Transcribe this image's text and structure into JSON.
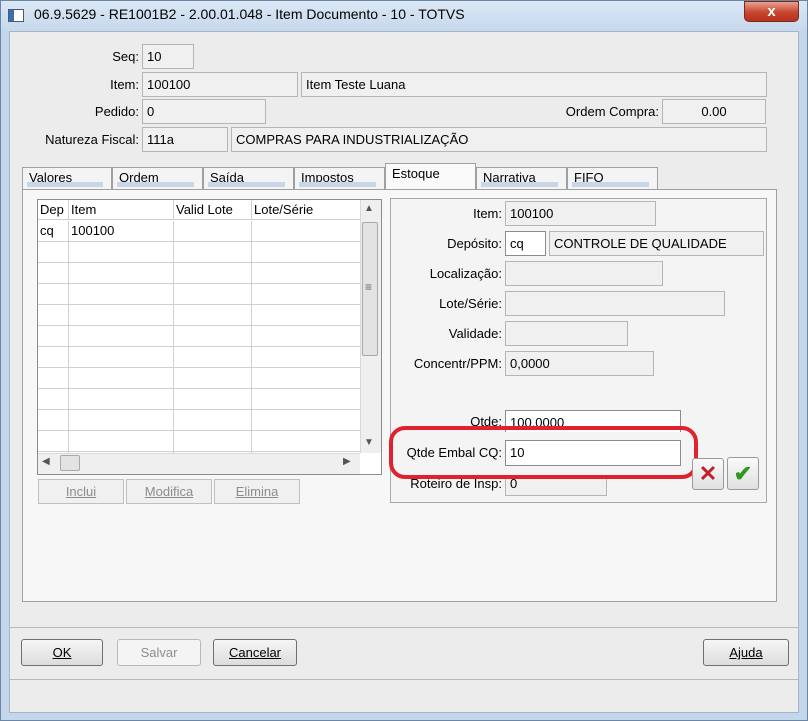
{
  "window": {
    "title": "06.9.5629 - RE1001B2 - 2.00.01.048 - Item Documento - 10 - TOTVS",
    "close_glyph": "x"
  },
  "header": {
    "seq": {
      "label": "Seq:",
      "value": "10"
    },
    "item": {
      "label": "Item:",
      "code": "100100",
      "description": "Item Teste Luana"
    },
    "pedido": {
      "label": "Pedido:",
      "value": "0"
    },
    "ordem_compra": {
      "label": "Ordem Compra:",
      "value": "0.00"
    },
    "natureza": {
      "label": "Natureza Fiscal:",
      "code": "111a",
      "description": "COMPRAS PARA INDUSTRIALIZAÇÃO"
    }
  },
  "tabs": [
    {
      "label": "Valores"
    },
    {
      "label": "Ordem"
    },
    {
      "label": "Saída"
    },
    {
      "label": "Impostos"
    },
    {
      "label": "Estoque"
    },
    {
      "label": "Narrativa"
    },
    {
      "label": "FIFO"
    }
  ],
  "grid": {
    "columns": [
      "Dep",
      "Item",
      "Valid Lote",
      "Lote/Série"
    ],
    "rows": [
      [
        "cq",
        "100100",
        "",
        ""
      ]
    ],
    "buttons": {
      "inclui": "Inclui",
      "modifica": "Modifica",
      "elimina": "Elimina"
    }
  },
  "estoque": {
    "item": {
      "label": "Item:",
      "value": "100100"
    },
    "deposito": {
      "label": "Depósito:",
      "code": "cq",
      "description": "CONTROLE DE QUALIDADE"
    },
    "localizacao": {
      "label": "Localização:",
      "value": ""
    },
    "lote": {
      "label": "Lote/Série:",
      "value": ""
    },
    "validade": {
      "label": "Validade:",
      "value": ""
    },
    "concentr": {
      "label": "Concentr/PPM:",
      "value": "0,0000"
    },
    "qtde": {
      "label": "Qtde:",
      "value": "100,0000"
    },
    "qtde_embal": {
      "label": "Qtde Embal CQ:",
      "value": "10"
    },
    "roteiro": {
      "label": "Roteiro de Insp:",
      "value": "0"
    },
    "cancel_glyph": "✕",
    "confirm_glyph": "✔"
  },
  "footer": {
    "ok": "OK",
    "salvar": "Salvar",
    "cancelar": "Cancelar",
    "ajuda": "Ajuda"
  },
  "colors": {
    "highlight_ring": "#e1212d",
    "confirm_green": "#2c9a1e",
    "cancel_red": "#c0202a"
  }
}
